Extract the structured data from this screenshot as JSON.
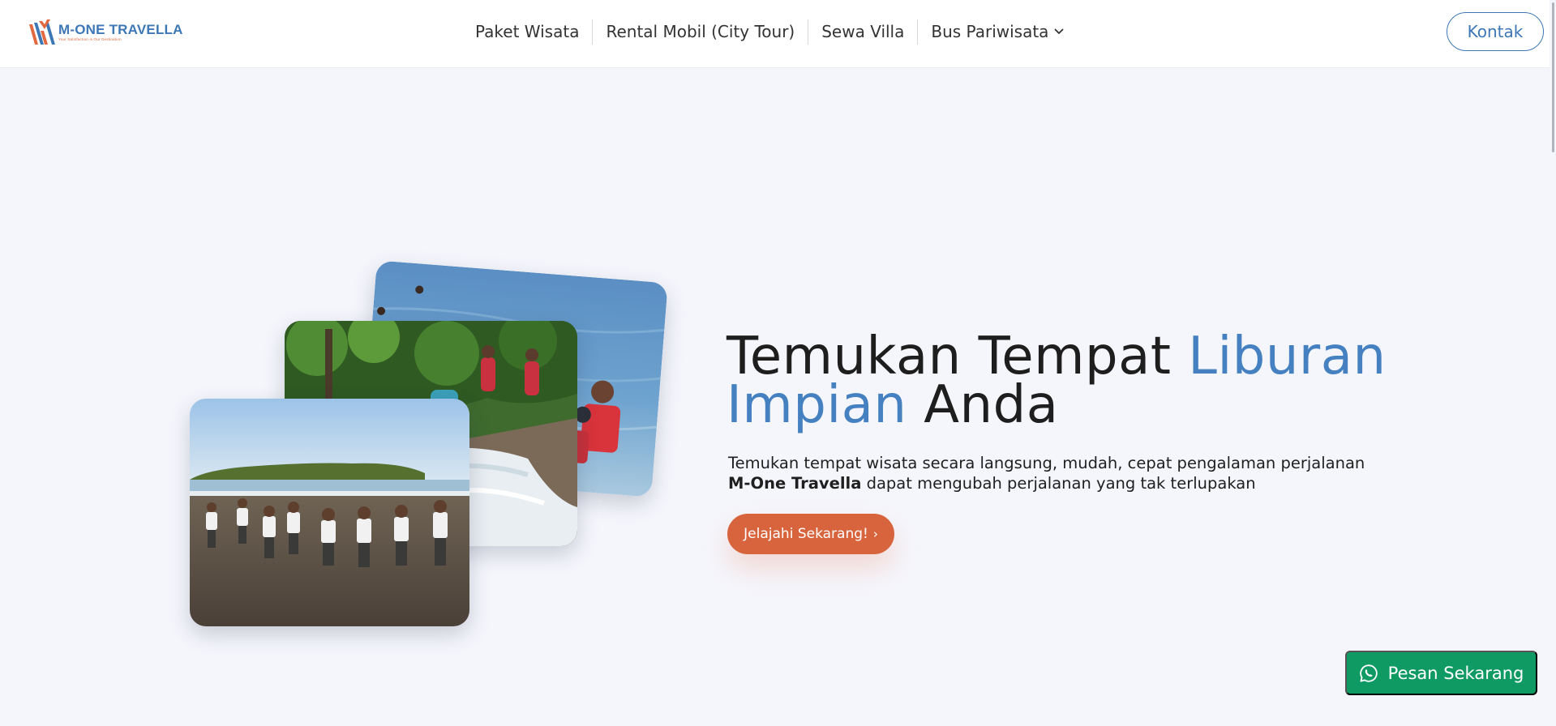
{
  "brand": {
    "name": "M-ONE TRAVELLA",
    "tagline": "Your Satisfaction is Our Destination"
  },
  "nav": {
    "items": [
      {
        "label": "Paket Wisata"
      },
      {
        "label": "Rental Mobil (City Tour)"
      },
      {
        "label": "Sewa Villa"
      },
      {
        "label": "Bus Pariwisata",
        "icon": "chevron-down-icon"
      }
    ],
    "contact_label": "Kontak"
  },
  "hero": {
    "title_part1": "Temukan Tempat ",
    "title_accent1": "Liburan",
    "title_accent2": "Impian",
    "title_part2": " Anda",
    "desc_line1": "Temukan tempat wisata secara langsung, mudah, cepat pengalaman perjalanan",
    "desc_brand": "M-One Travella",
    "desc_line2": " dapat mengubah perjalanan yang tak terlupakan",
    "cta_label": "Jelajahi Sekarang!",
    "cta_arrow": "›"
  },
  "float_button": {
    "label": "Pesan Sekarang",
    "icon": "whatsapp-icon"
  },
  "colors": {
    "accent_blue": "#4581c0",
    "cta_orange": "#d8643d",
    "whatsapp_green": "#0f9a63",
    "background": "#f5f6fc"
  }
}
